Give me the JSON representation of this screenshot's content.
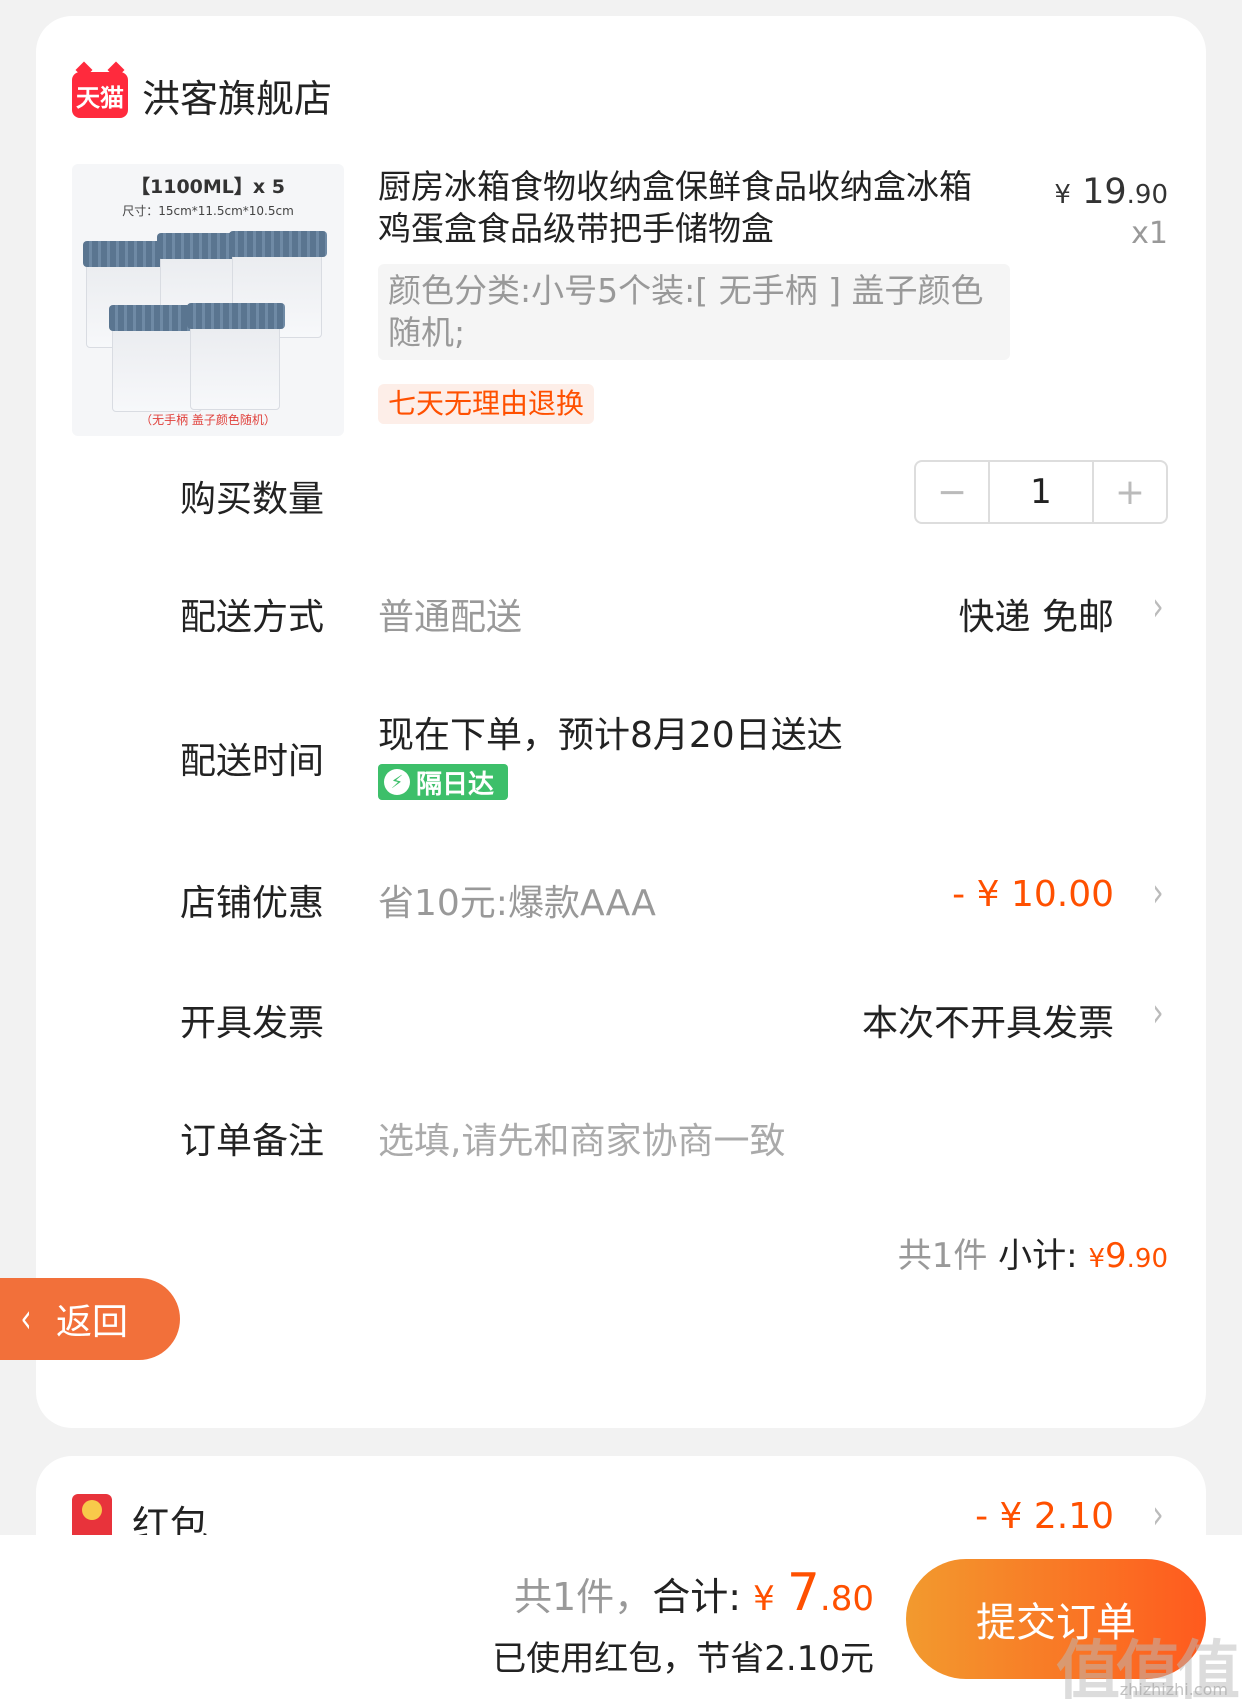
{
  "store": {
    "logo_text": "天猫",
    "name": "洪客旗舰店"
  },
  "product": {
    "image_caption_top": "【1100ML】x 5",
    "image_caption_size": "尺寸：15cm*11.5cm*10.5cm",
    "image_caption_bottom": "（无手柄  盖子颜色随机）",
    "title": "厨房冰箱食物收纳盒保鲜食品收纳盒冰箱鸡蛋盒食品级带把手储物盒",
    "price_currency": "¥",
    "price_int": "19",
    "price_dec": ".90",
    "quantity_label": "x1",
    "sku": "颜色分类:小号5个装:[ 无手柄 ] 盖子颜色随机;",
    "return_badge": "七天无理由退换"
  },
  "quantity_row": {
    "label": "购买数量",
    "minus": "−",
    "value": "1",
    "plus": "+"
  },
  "delivery_method": {
    "label": "配送方式",
    "sub": "普通配送",
    "value": "快递 免邮",
    "chevron": "›"
  },
  "delivery_time": {
    "label": "配送时间",
    "value": "现在下单，预计8月20日送达",
    "badge_icon": "⚡",
    "badge": "隔日达"
  },
  "store_discount": {
    "label": "店铺优惠",
    "sub": "省10元:爆款AAA",
    "value": "- ¥ 10.00",
    "chevron": "›"
  },
  "invoice": {
    "label": "开具发票",
    "value": "本次不开具发票",
    "chevron": "›"
  },
  "note": {
    "label": "订单备注",
    "placeholder": "选填,请先和商家协商一致"
  },
  "subtotal": {
    "count": "共1件",
    "label": "小计:",
    "currency": "¥",
    "int": "9",
    "dec": ".90"
  },
  "red_packet": {
    "label": "红包",
    "value": "- ¥ 2.10",
    "chevron": "›"
  },
  "back": {
    "chevron": "‹",
    "label": "返回"
  },
  "bottom": {
    "count": "共1件，",
    "total_label": "合计:",
    "currency": "¥",
    "total_int": "7",
    "total_dec": ".80",
    "saved": "已使用红包，节省2.10元",
    "submit": "提交订单"
  },
  "watermark": {
    "main": "值值值",
    "sub": "zhizhizhi.com"
  },
  "colors": {
    "accent": "#ff5000",
    "tmall_red": "#ff2a3d",
    "back_button": "#f2703a",
    "nextday_green": "#3dbf6a"
  }
}
